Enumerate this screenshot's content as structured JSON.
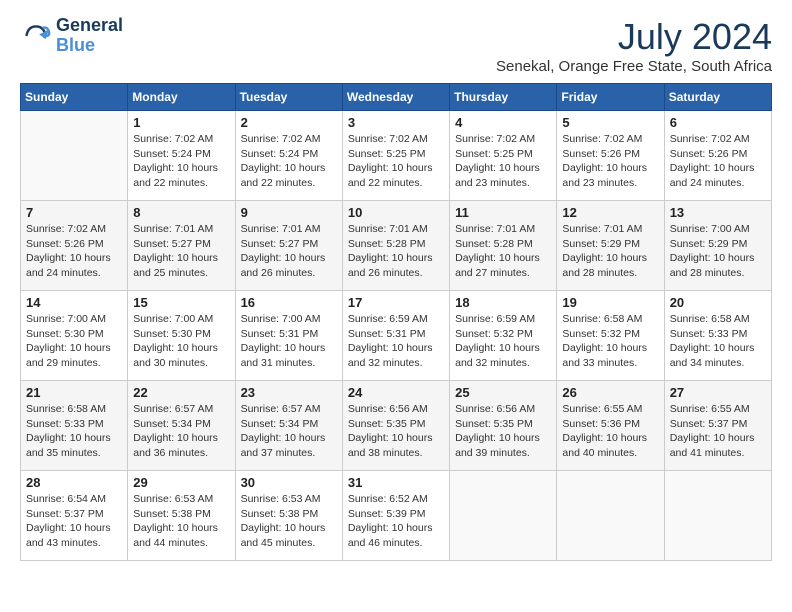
{
  "logo": {
    "line1": "General",
    "line2": "Blue",
    "icon_color": "#4a90d9"
  },
  "title": {
    "month_year": "July 2024",
    "location": "Senekal, Orange Free State, South Africa"
  },
  "headers": [
    "Sunday",
    "Monday",
    "Tuesday",
    "Wednesday",
    "Thursday",
    "Friday",
    "Saturday"
  ],
  "weeks": [
    [
      {
        "day": "",
        "detail": ""
      },
      {
        "day": "1",
        "detail": "Sunrise: 7:02 AM\nSunset: 5:24 PM\nDaylight: 10 hours\nand 22 minutes."
      },
      {
        "day": "2",
        "detail": "Sunrise: 7:02 AM\nSunset: 5:24 PM\nDaylight: 10 hours\nand 22 minutes."
      },
      {
        "day": "3",
        "detail": "Sunrise: 7:02 AM\nSunset: 5:25 PM\nDaylight: 10 hours\nand 22 minutes."
      },
      {
        "day": "4",
        "detail": "Sunrise: 7:02 AM\nSunset: 5:25 PM\nDaylight: 10 hours\nand 23 minutes."
      },
      {
        "day": "5",
        "detail": "Sunrise: 7:02 AM\nSunset: 5:26 PM\nDaylight: 10 hours\nand 23 minutes."
      },
      {
        "day": "6",
        "detail": "Sunrise: 7:02 AM\nSunset: 5:26 PM\nDaylight: 10 hours\nand 24 minutes."
      }
    ],
    [
      {
        "day": "7",
        "detail": "Sunrise: 7:02 AM\nSunset: 5:26 PM\nDaylight: 10 hours\nand 24 minutes."
      },
      {
        "day": "8",
        "detail": "Sunrise: 7:01 AM\nSunset: 5:27 PM\nDaylight: 10 hours\nand 25 minutes."
      },
      {
        "day": "9",
        "detail": "Sunrise: 7:01 AM\nSunset: 5:27 PM\nDaylight: 10 hours\nand 26 minutes."
      },
      {
        "day": "10",
        "detail": "Sunrise: 7:01 AM\nSunset: 5:28 PM\nDaylight: 10 hours\nand 26 minutes."
      },
      {
        "day": "11",
        "detail": "Sunrise: 7:01 AM\nSunset: 5:28 PM\nDaylight: 10 hours\nand 27 minutes."
      },
      {
        "day": "12",
        "detail": "Sunrise: 7:01 AM\nSunset: 5:29 PM\nDaylight: 10 hours\nand 28 minutes."
      },
      {
        "day": "13",
        "detail": "Sunrise: 7:00 AM\nSunset: 5:29 PM\nDaylight: 10 hours\nand 28 minutes."
      }
    ],
    [
      {
        "day": "14",
        "detail": "Sunrise: 7:00 AM\nSunset: 5:30 PM\nDaylight: 10 hours\nand 29 minutes."
      },
      {
        "day": "15",
        "detail": "Sunrise: 7:00 AM\nSunset: 5:30 PM\nDaylight: 10 hours\nand 30 minutes."
      },
      {
        "day": "16",
        "detail": "Sunrise: 7:00 AM\nSunset: 5:31 PM\nDaylight: 10 hours\nand 31 minutes."
      },
      {
        "day": "17",
        "detail": "Sunrise: 6:59 AM\nSunset: 5:31 PM\nDaylight: 10 hours\nand 32 minutes."
      },
      {
        "day": "18",
        "detail": "Sunrise: 6:59 AM\nSunset: 5:32 PM\nDaylight: 10 hours\nand 32 minutes."
      },
      {
        "day": "19",
        "detail": "Sunrise: 6:58 AM\nSunset: 5:32 PM\nDaylight: 10 hours\nand 33 minutes."
      },
      {
        "day": "20",
        "detail": "Sunrise: 6:58 AM\nSunset: 5:33 PM\nDaylight: 10 hours\nand 34 minutes."
      }
    ],
    [
      {
        "day": "21",
        "detail": "Sunrise: 6:58 AM\nSunset: 5:33 PM\nDaylight: 10 hours\nand 35 minutes."
      },
      {
        "day": "22",
        "detail": "Sunrise: 6:57 AM\nSunset: 5:34 PM\nDaylight: 10 hours\nand 36 minutes."
      },
      {
        "day": "23",
        "detail": "Sunrise: 6:57 AM\nSunset: 5:34 PM\nDaylight: 10 hours\nand 37 minutes."
      },
      {
        "day": "24",
        "detail": "Sunrise: 6:56 AM\nSunset: 5:35 PM\nDaylight: 10 hours\nand 38 minutes."
      },
      {
        "day": "25",
        "detail": "Sunrise: 6:56 AM\nSunset: 5:35 PM\nDaylight: 10 hours\nand 39 minutes."
      },
      {
        "day": "26",
        "detail": "Sunrise: 6:55 AM\nSunset: 5:36 PM\nDaylight: 10 hours\nand 40 minutes."
      },
      {
        "day": "27",
        "detail": "Sunrise: 6:55 AM\nSunset: 5:37 PM\nDaylight: 10 hours\nand 41 minutes."
      }
    ],
    [
      {
        "day": "28",
        "detail": "Sunrise: 6:54 AM\nSunset: 5:37 PM\nDaylight: 10 hours\nand 43 minutes."
      },
      {
        "day": "29",
        "detail": "Sunrise: 6:53 AM\nSunset: 5:38 PM\nDaylight: 10 hours\nand 44 minutes."
      },
      {
        "day": "30",
        "detail": "Sunrise: 6:53 AM\nSunset: 5:38 PM\nDaylight: 10 hours\nand 45 minutes."
      },
      {
        "day": "31",
        "detail": "Sunrise: 6:52 AM\nSunset: 5:39 PM\nDaylight: 10 hours\nand 46 minutes."
      },
      {
        "day": "",
        "detail": ""
      },
      {
        "day": "",
        "detail": ""
      },
      {
        "day": "",
        "detail": ""
      }
    ]
  ]
}
